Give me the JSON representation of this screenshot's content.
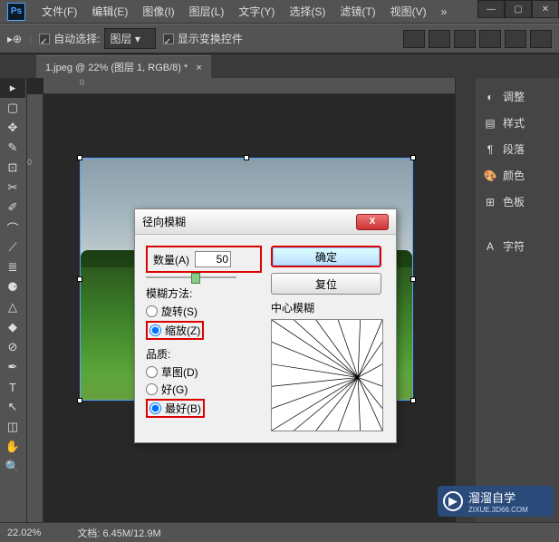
{
  "window": {
    "minimize": "—",
    "maximize": "▢",
    "close": "✕"
  },
  "menu": {
    "items": [
      "文件(F)",
      "编辑(E)",
      "图像(I)",
      "图层(L)",
      "文字(Y)",
      "选择(S)",
      "滤镜(T)",
      "视图(V)"
    ],
    "overflow": "»"
  },
  "options": {
    "auto_select": "自动选择:",
    "layer_dropdown": "图层",
    "show_transform": "显示变换控件"
  },
  "tab": {
    "title": "1.jpeg @ 22% (图层 1, RGB/8) *",
    "close": "×"
  },
  "ruler": {
    "h": [
      "0"
    ],
    "v": [
      "0"
    ]
  },
  "tools": [
    "▸",
    "▢",
    "✥",
    "✎",
    "⊡",
    "✂",
    "✐",
    "⌒",
    "⟋",
    "≣",
    "⚈",
    "△",
    "◆",
    "⊘",
    "✒",
    "T",
    "↖",
    "◫",
    "✋",
    "🔍"
  ],
  "panels": [
    {
      "icon": "◐",
      "label": "调整"
    },
    {
      "icon": "▤",
      "label": "样式"
    },
    {
      "icon": "¶",
      "label": "段落"
    },
    {
      "icon": "🎨",
      "label": "颜色"
    },
    {
      "icon": "⊞",
      "label": "色板"
    },
    {
      "icon": "A",
      "label": "字符"
    }
  ],
  "status": {
    "zoom": "22.02%",
    "doc_label": "文档:",
    "doc_size": "6.45M/12.9M"
  },
  "dialog": {
    "title": "径向模糊",
    "amount_label": "数量(A)",
    "amount_value": "50",
    "method_label": "模糊方法:",
    "method_spin": "旋转(S)",
    "method_zoom": "缩放(Z)",
    "quality_label": "品质:",
    "quality_draft": "草图(D)",
    "quality_good": "好(G)",
    "quality_best": "最好(B)",
    "ok": "确定",
    "reset": "复位",
    "preview_label": "中心模糊",
    "close": "X"
  },
  "watermark": {
    "brand": "溜溜自学",
    "sub": "ZIXUE.3D66.COM",
    "play": "▶"
  }
}
